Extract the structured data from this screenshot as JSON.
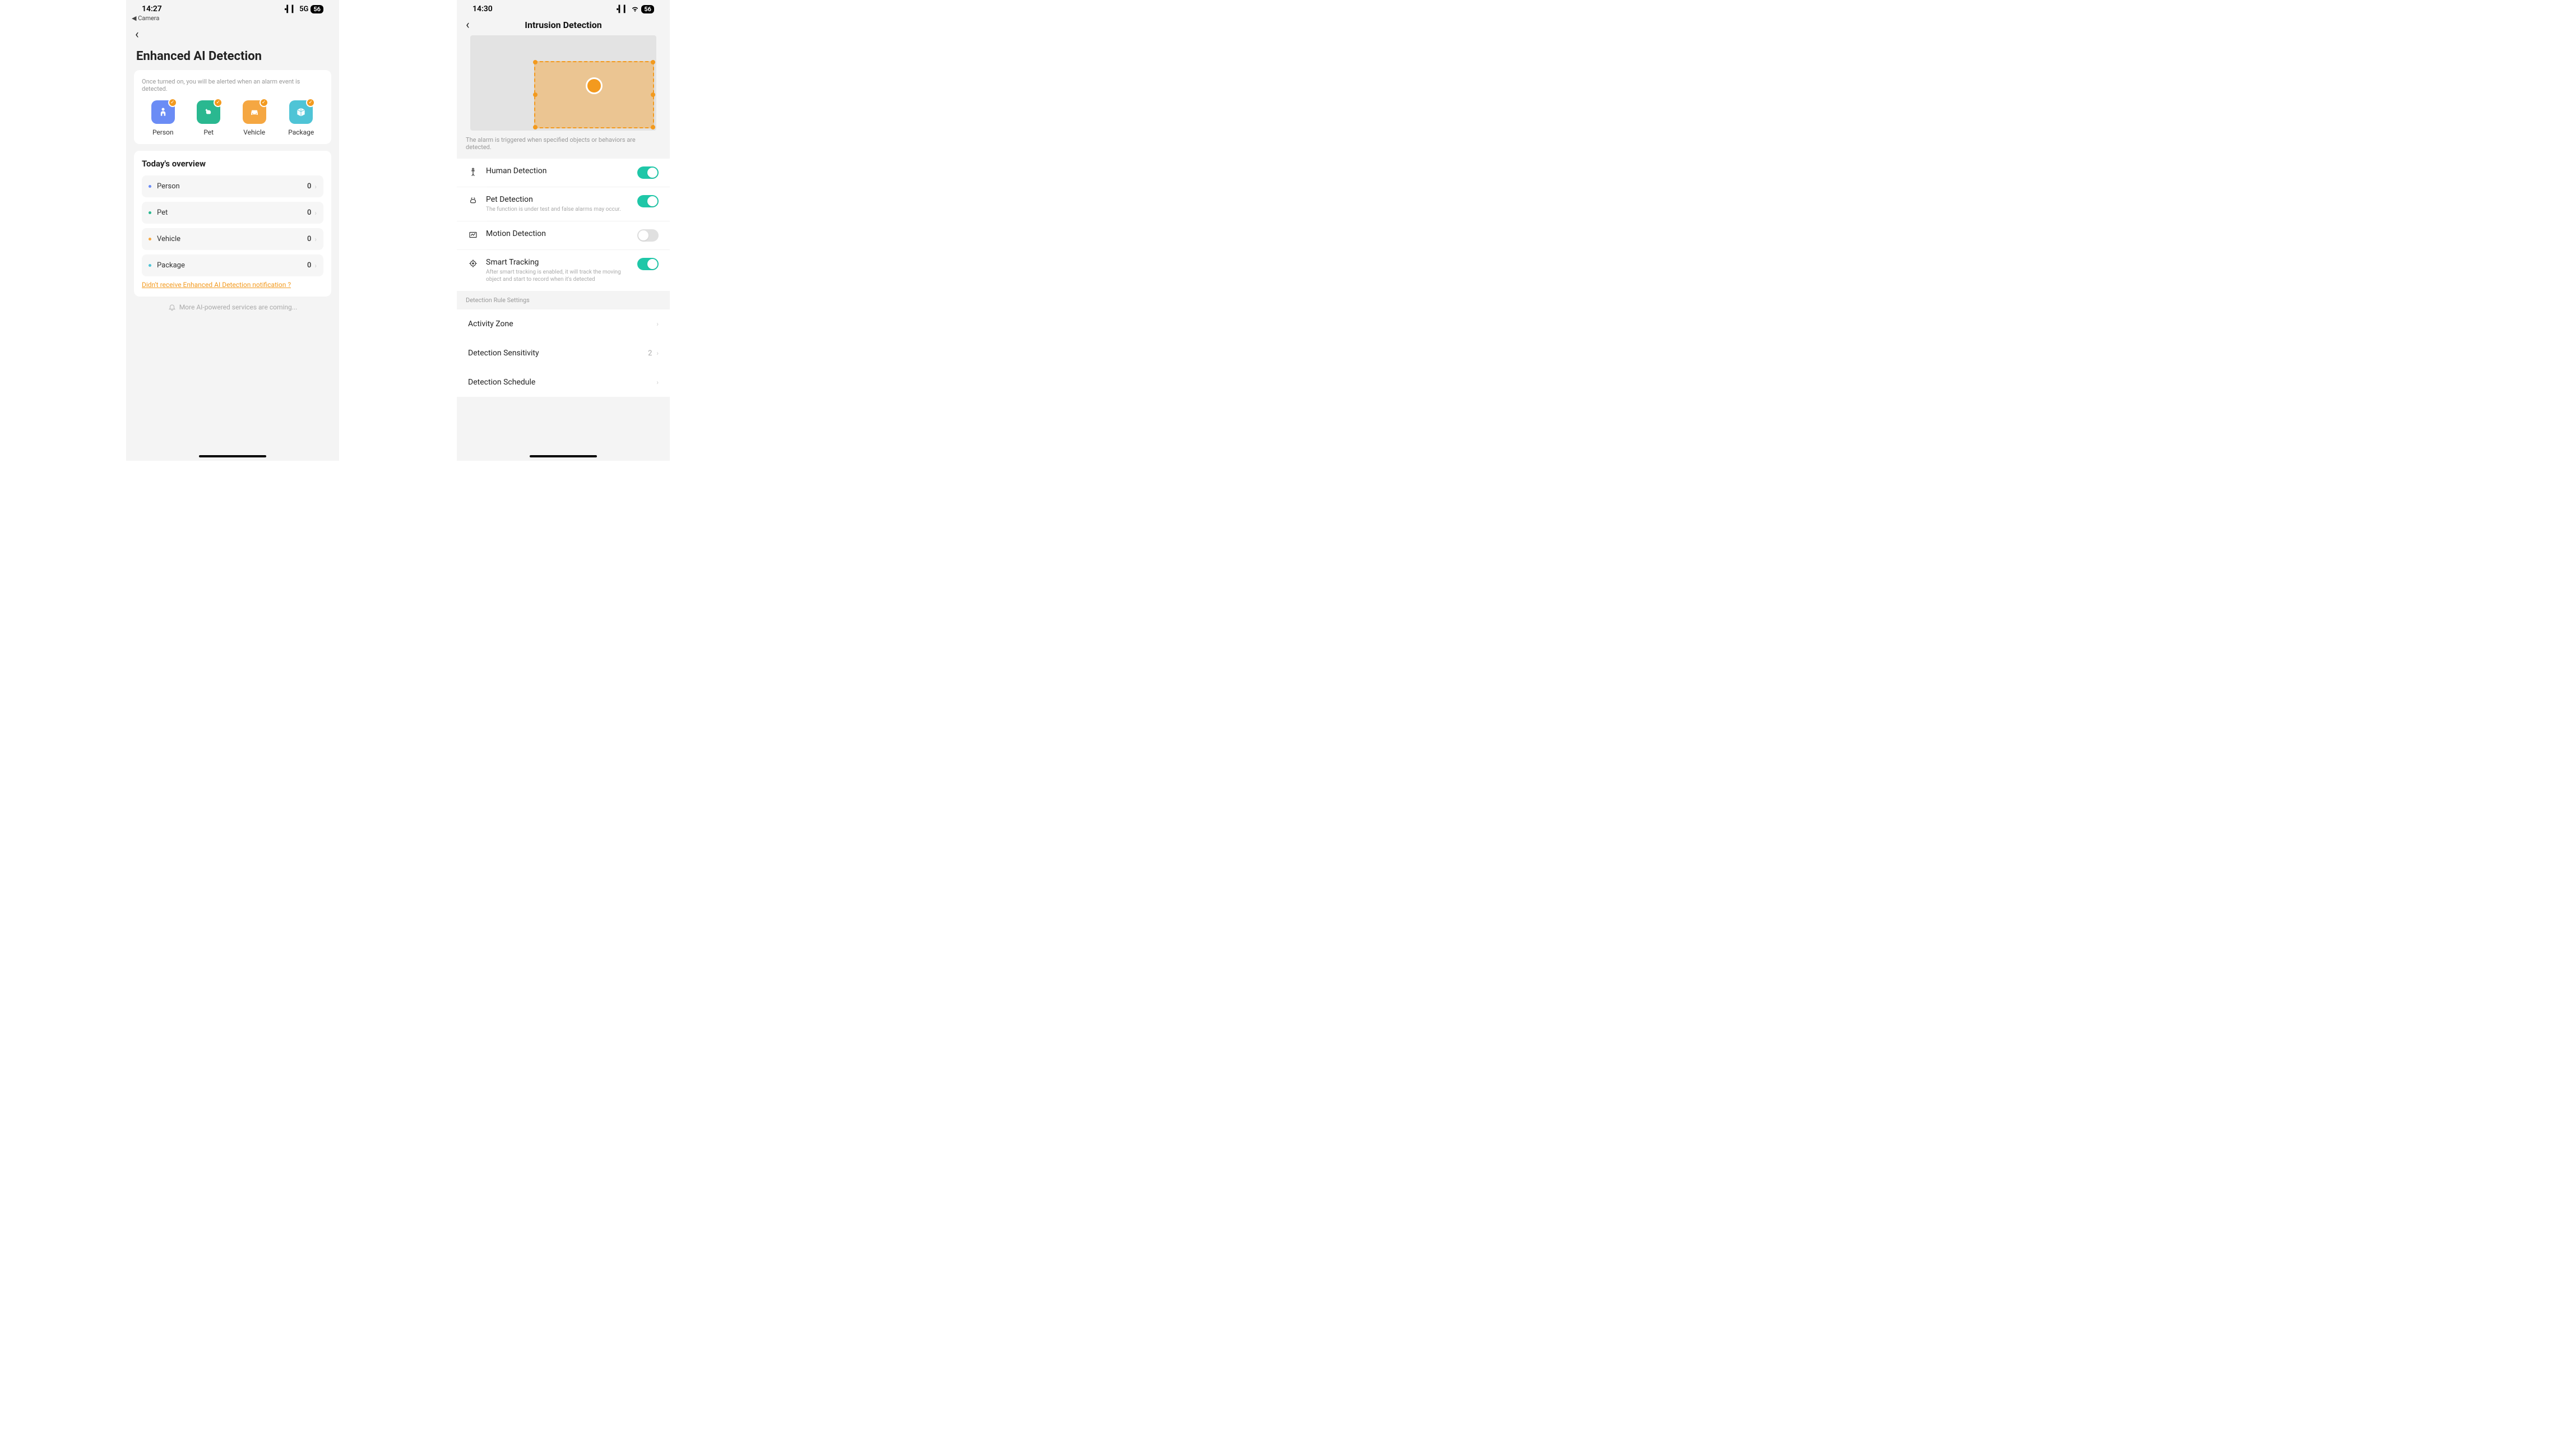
{
  "screen1": {
    "status": {
      "time": "14:27",
      "net": "5G",
      "battery": "56",
      "back_app": "◀ Camera"
    },
    "title": "Enhanced AI Detection",
    "hint": "Once turned on, you will be alerted when an alarm event is detected.",
    "types": {
      "person": "Person",
      "pet": "Pet",
      "vehicle": "Vehicle",
      "package": "Package"
    },
    "overview": {
      "title": "Today's overview",
      "rows": [
        {
          "label": "Person",
          "count": "0",
          "color": "#6b8cf5"
        },
        {
          "label": "Pet",
          "count": "0",
          "color": "#2ab890"
        },
        {
          "label": "Vehicle",
          "count": "0",
          "color": "#f5a742"
        },
        {
          "label": "Package",
          "count": "0",
          "color": "#4fc4d6"
        }
      ],
      "help_link": "Didn't receive Enhanced AI Detection notification ?"
    },
    "footer": "More AI-powered services are coming..."
  },
  "screen2": {
    "status": {
      "time": "14:30",
      "battery": "56"
    },
    "title": "Intrusion Detection",
    "preview_caption": "The alarm is triggered when specified objects or behaviors are detected.",
    "settings": {
      "human": {
        "title": "Human Detection",
        "on": true
      },
      "pet": {
        "title": "Pet Detection",
        "sub": "The function is under test and false alarms may occur.",
        "on": true
      },
      "motion": {
        "title": "Motion Detection",
        "on": false
      },
      "tracking": {
        "title": "Smart Tracking",
        "sub": "After smart tracking is enabled, it will track the moving object and start to record when it's detected",
        "on": true
      }
    },
    "rules": {
      "header": "Detection Rule Settings",
      "activity_zone": "Activity Zone",
      "sensitivity": {
        "label": "Detection Sensitivity",
        "value": "2"
      },
      "schedule": "Detection Schedule"
    }
  }
}
